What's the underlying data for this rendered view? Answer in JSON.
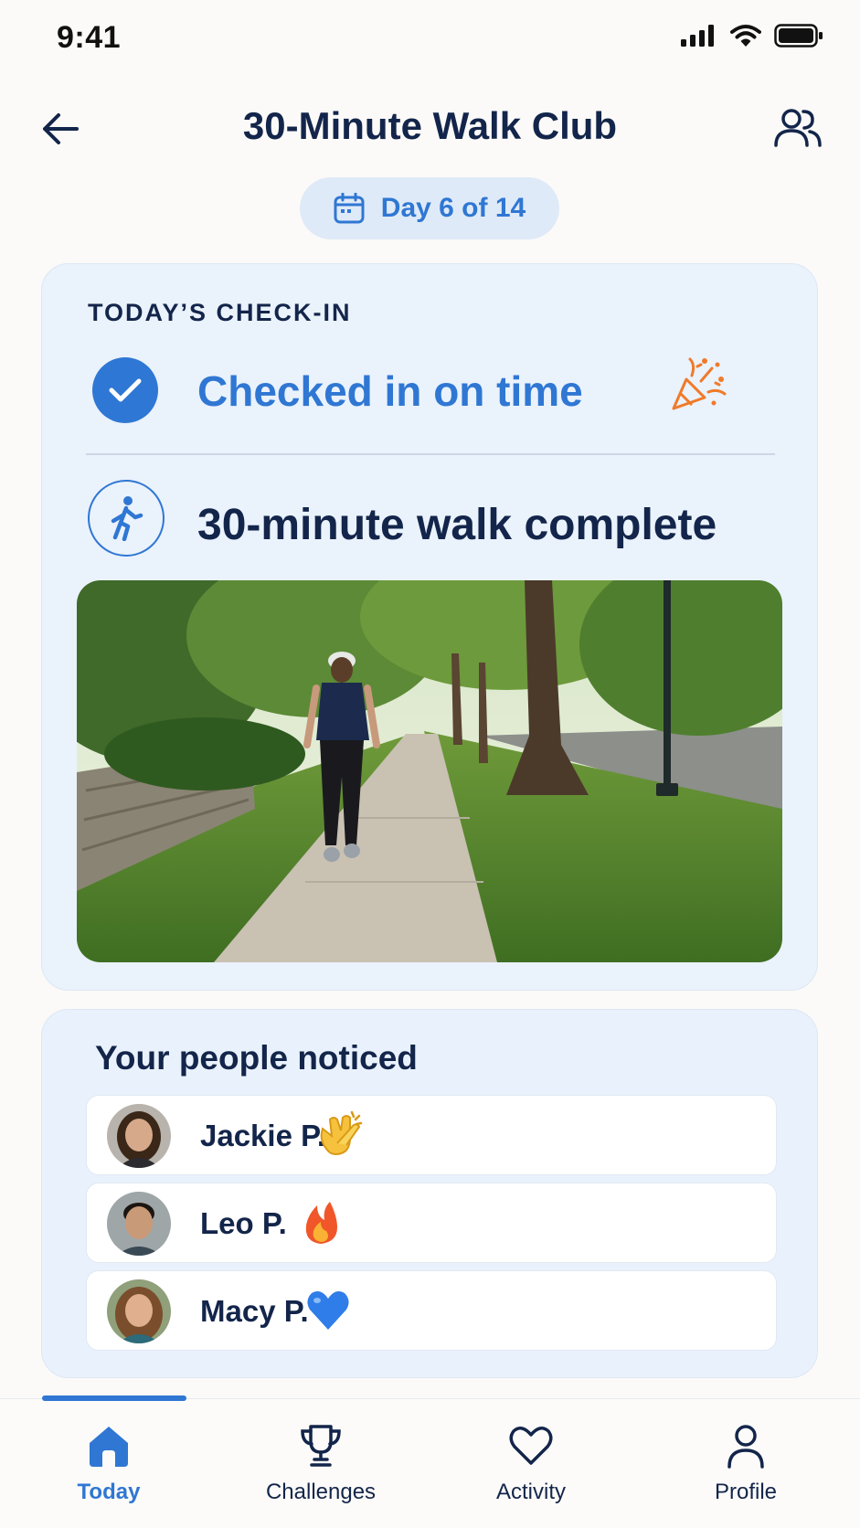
{
  "status_bar": {
    "time": "9:41"
  },
  "header": {
    "title": "30-Minute Walk Club",
    "day_label": "Day 6 of 14"
  },
  "checkin": {
    "heading": "TODAY’S CHECK-IN",
    "status": "Checked in on time",
    "walk_status": "30-minute walk complete"
  },
  "noticed": {
    "heading": "Your people noticed",
    "people": [
      {
        "name": "Jackie P.",
        "reaction": "clapping-hands-icon"
      },
      {
        "name": "Leo P.",
        "reaction": "fire-icon"
      },
      {
        "name": "Macy P.",
        "reaction": "blue-heart-icon"
      }
    ]
  },
  "tabs": [
    {
      "label": "Today",
      "icon": "home-icon",
      "active": true
    },
    {
      "label": "Challenges",
      "icon": "trophy-icon",
      "active": false
    },
    {
      "label": "Activity",
      "icon": "heart-icon",
      "active": false
    },
    {
      "label": "Profile",
      "icon": "person-icon",
      "active": false
    }
  ],
  "colors": {
    "accent": "#2f77d3",
    "navy": "#13254a",
    "card": "#eaf2fc",
    "confetti": "#f07a2a"
  }
}
